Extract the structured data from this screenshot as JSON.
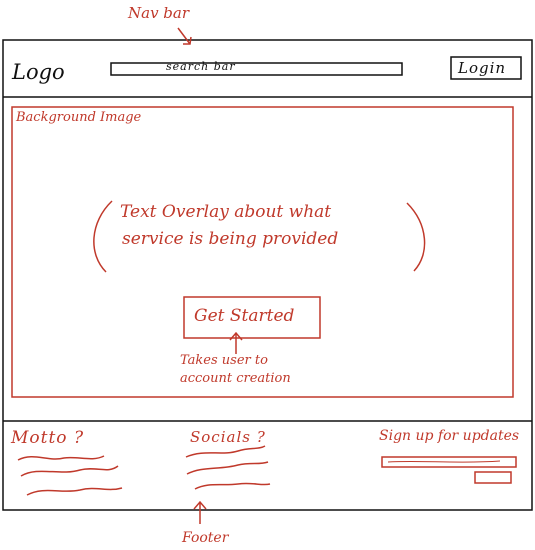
{
  "annotations": {
    "navbar": "Nav bar",
    "footer": "Footer",
    "cta_note_line1": "Takes user to",
    "cta_note_line2": "account creation"
  },
  "navbar": {
    "logo": "Logo",
    "search_bar": "search bar",
    "login": "Login"
  },
  "hero": {
    "background_label": "Background Image",
    "overlay_line1": "Text Overlay about what",
    "overlay_line2": "service is being provided",
    "cta_label": "Get Started"
  },
  "footer": {
    "motto": "Motto ?",
    "socials": "Socials ?",
    "signup": "Sign up for updates"
  },
  "colors": {
    "ink": "#111111",
    "accent": "#c0392b"
  }
}
